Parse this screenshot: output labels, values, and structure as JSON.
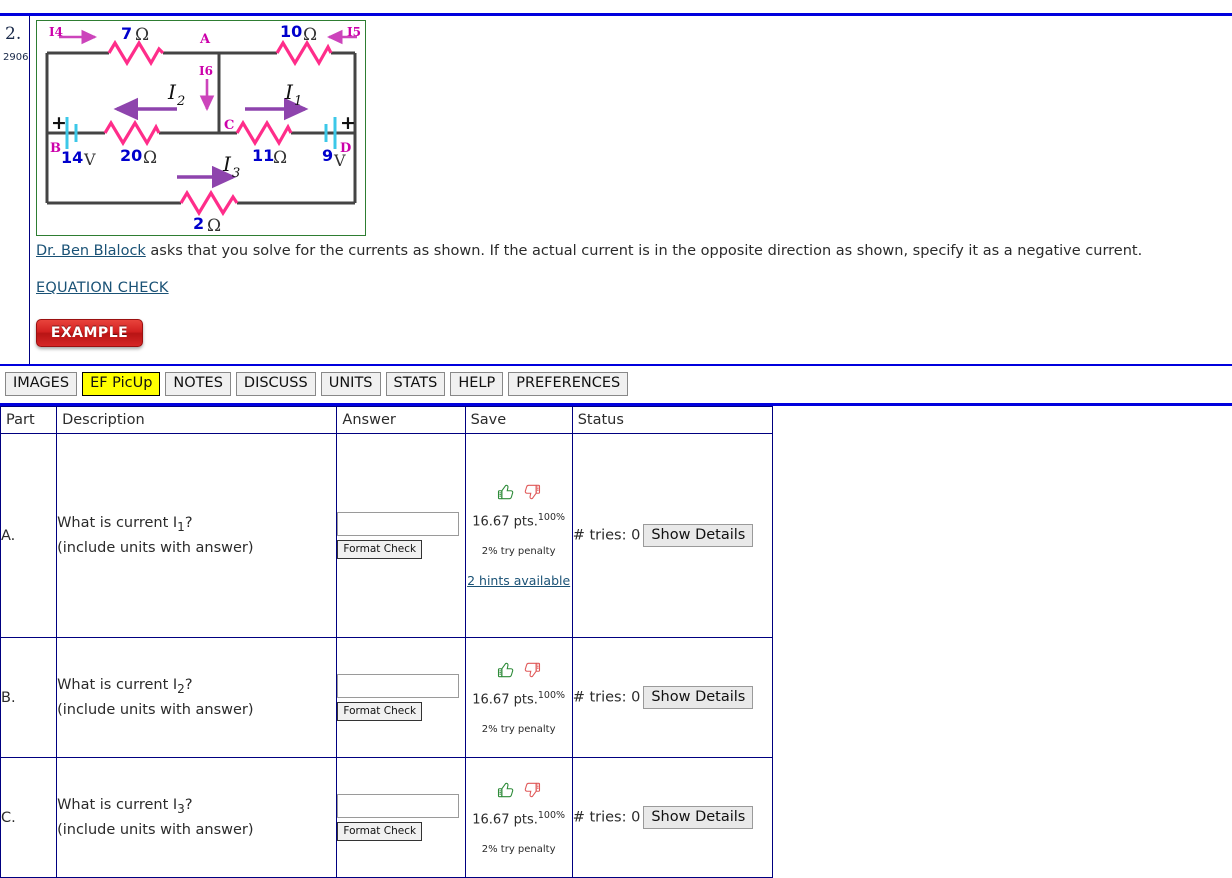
{
  "problem": {
    "number": "2.",
    "id": "2906",
    "prose_link": "Dr. Ben Blalock",
    "prose_rest": " asks that you solve for the currents as shown. If the actual current is in the opposite direction as shown, specify it as a negative current.",
    "equation_check_label": "EQUATION CHECK",
    "example_badge": "EXAMPLE"
  },
  "circuit": {
    "caption_labels": {
      "node_a": "A",
      "node_b": "B",
      "node_c": "C",
      "node_d": "D"
    },
    "currents": {
      "i1": "I",
      "i1_sub": "1",
      "i2": "I",
      "i2_sub": "2",
      "i3": "I",
      "i3_sub": "3",
      "i4": "I4",
      "i5": "I5",
      "i6": "I6"
    },
    "resistors": {
      "top_left": "7",
      "top_right": "10",
      "mid_left": "20",
      "mid_right": "11",
      "bottom": "2",
      "unit": "Ω"
    },
    "batteries": {
      "left_value": "14",
      "left_unit": "V",
      "left_polarity": "+",
      "right_value": "9",
      "right_unit": "V",
      "right_polarity": "+"
    }
  },
  "toolbar": {
    "buttons": [
      {
        "label": "IMAGES",
        "active": false
      },
      {
        "label": "EF PicUp",
        "active": true
      },
      {
        "label": "NOTES",
        "active": false
      },
      {
        "label": "DISCUSS",
        "active": false
      },
      {
        "label": "UNITS",
        "active": false
      },
      {
        "label": "STATS",
        "active": false
      },
      {
        "label": "HELP",
        "active": false
      },
      {
        "label": "PREFERENCES",
        "active": false
      }
    ]
  },
  "table": {
    "headers": [
      "Part",
      "Description",
      "Answer",
      "Save",
      "Status"
    ],
    "rows": [
      {
        "part": "A.",
        "question": "What is current I",
        "question_sub": "1",
        "question_tail": "?",
        "note": "(include units with answer)",
        "answer_value": "",
        "answer_placeholder": "",
        "format_check": "Format Check",
        "points": "16.67 pts.",
        "points_pct": "100%",
        "penalty": "2% try penalty",
        "hints": "2 hints available",
        "tries": "# tries: 0",
        "details_button": "Show Details"
      },
      {
        "part": "B.",
        "question": "What is current I",
        "question_sub": "2",
        "question_tail": "?",
        "note": "(include units with answer)",
        "answer_value": "",
        "answer_placeholder": "",
        "format_check": "Format Check",
        "points": "16.67 pts.",
        "points_pct": "100%",
        "penalty": "2% try penalty",
        "hints": "",
        "tries": "# tries: 0",
        "details_button": "Show Details"
      },
      {
        "part": "C.",
        "question": "What is current I",
        "question_sub": "3",
        "question_tail": "?",
        "note": "(include units with answer)",
        "answer_value": "",
        "answer_placeholder": "",
        "format_check": "Format Check",
        "points": "16.67 pts.",
        "points_pct": "100%",
        "penalty": "2% try penalty",
        "hints": "",
        "tries": "# tries: 0",
        "details_button": "Show Details"
      }
    ]
  },
  "colors": {
    "rule_blue": "#0000dd",
    "table_border": "#000080",
    "link": "#1a5276",
    "highlight": "#ffff00",
    "figure_border": "#2e7d32",
    "resistor_pink": "#ff2d8a",
    "current_purple": "#8e44ad",
    "label_magenta": "#cc00aa",
    "value_blue": "#0000cc",
    "battery_cyan": "#3cc8e8",
    "thumb_up_green": "#2e8b39",
    "thumb_down_red": "#e05a5a",
    "example_red": "#d22020"
  }
}
